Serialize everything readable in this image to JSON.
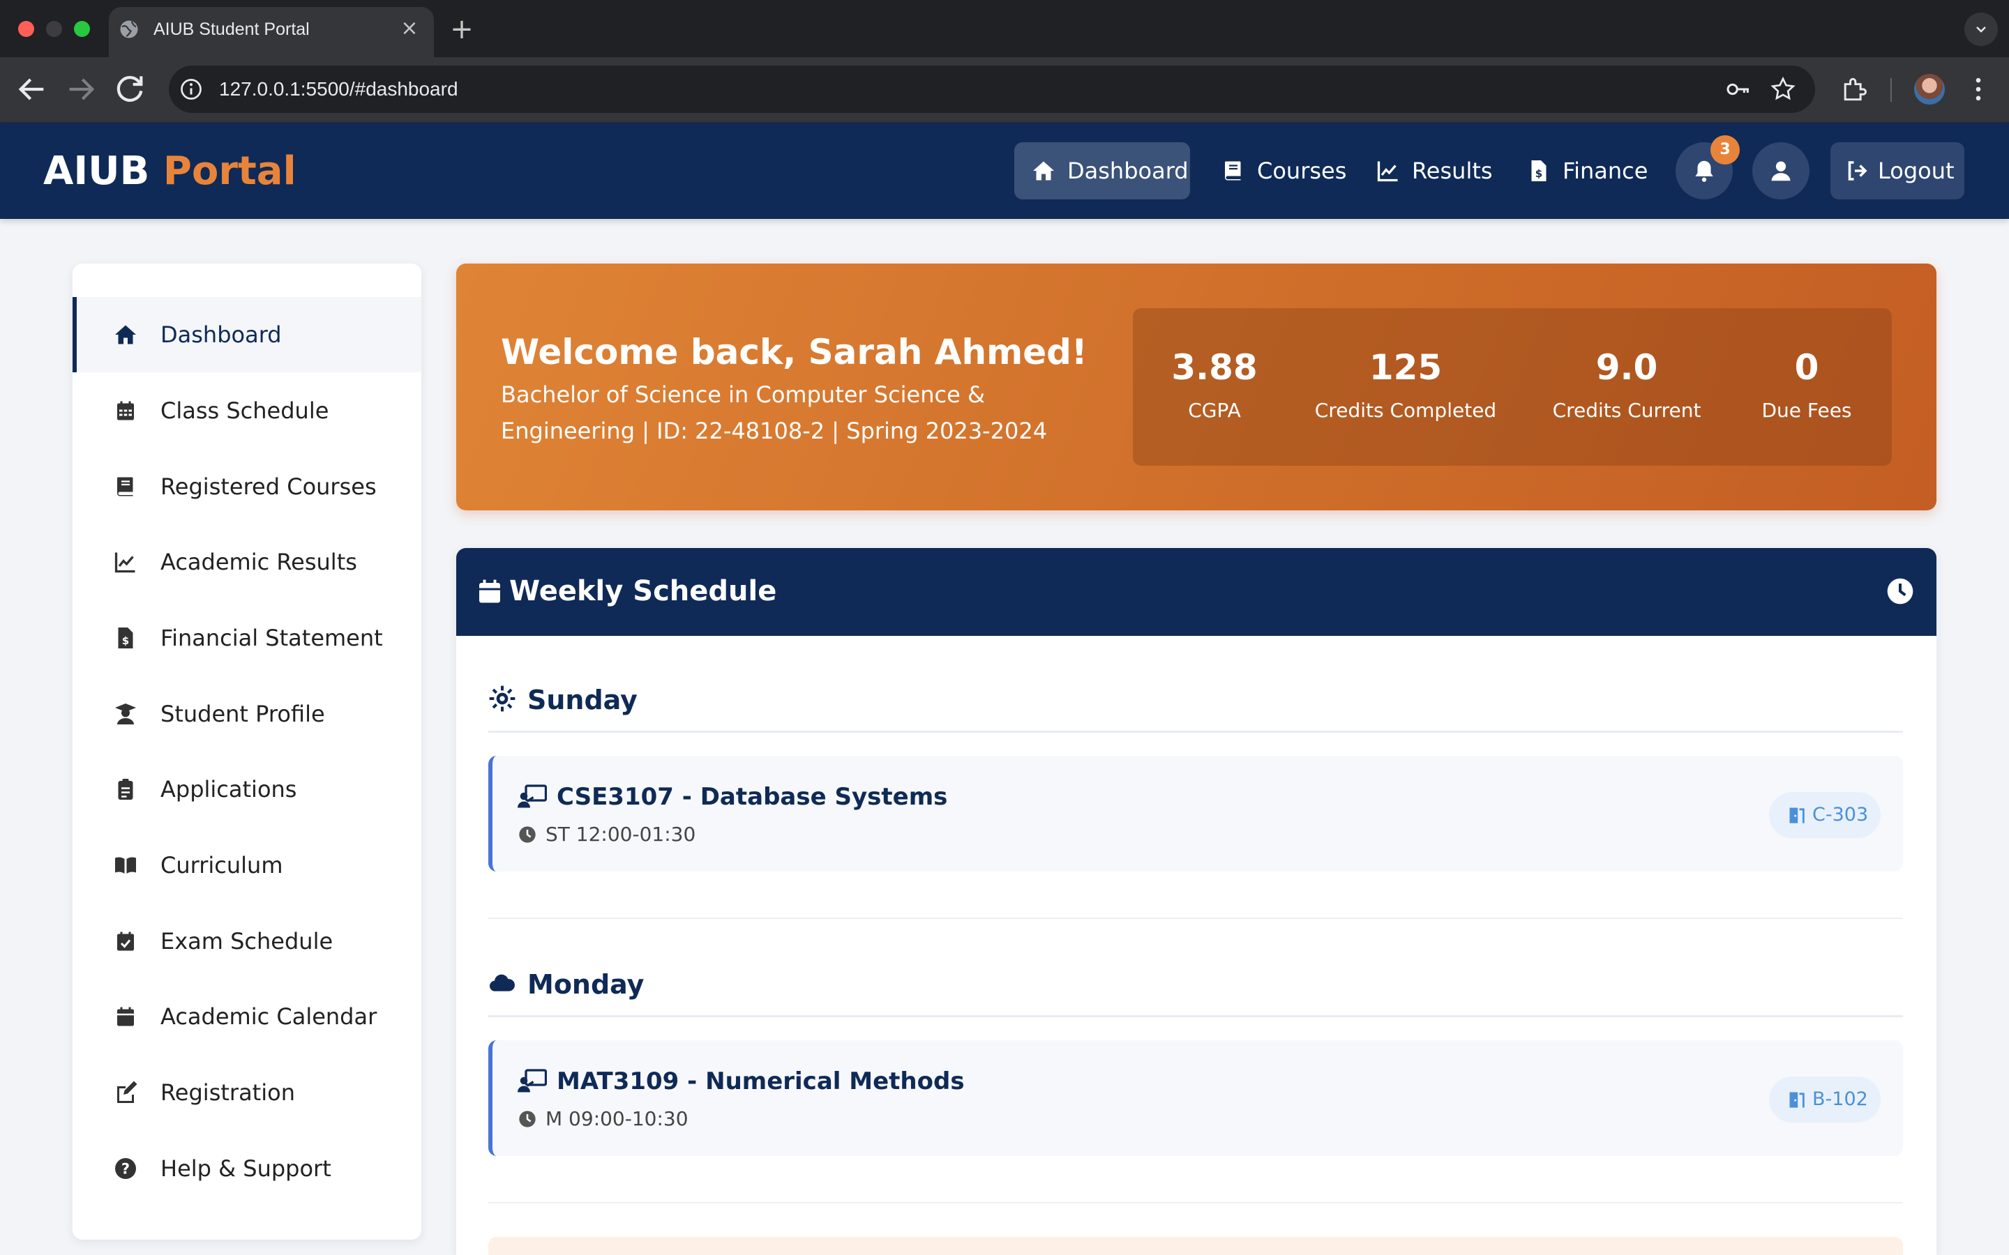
{
  "browser": {
    "tab_title": "AIUB Student Portal",
    "tab_close": "×",
    "new_tab": "+",
    "url": "127.0.0.1:5500/#dashboard"
  },
  "header": {
    "brand_part1": "AIUB",
    "brand_part2": "Portal",
    "nav": [
      {
        "label": "Dashboard",
        "icon": "home-icon"
      },
      {
        "label": "Courses",
        "icon": "book-icon"
      },
      {
        "label": "Results",
        "icon": "chart-line-icon"
      },
      {
        "label": "Finance",
        "icon": "file-invoice-dollar-icon"
      }
    ],
    "notification_count": "3",
    "logout_label": "Logout"
  },
  "sidebar": {
    "items": [
      {
        "label": "Dashboard",
        "icon": "home-icon"
      },
      {
        "label": "Class Schedule",
        "icon": "calendar-grid-icon"
      },
      {
        "label": "Registered Courses",
        "icon": "book-icon"
      },
      {
        "label": "Academic Results",
        "icon": "chart-line-icon"
      },
      {
        "label": "Financial Statement",
        "icon": "file-invoice-dollar-icon"
      },
      {
        "label": "Student Profile",
        "icon": "user-graduate-icon"
      },
      {
        "label": "Applications",
        "icon": "clipboard-list-icon"
      },
      {
        "label": "Curriculum",
        "icon": "book-open-icon"
      },
      {
        "label": "Exam Schedule",
        "icon": "calendar-check-icon"
      },
      {
        "label": "Academic Calendar",
        "icon": "calendar-icon"
      },
      {
        "label": "Registration",
        "icon": "edit-icon"
      },
      {
        "label": "Help & Support",
        "icon": "question-circle-icon"
      }
    ]
  },
  "welcome": {
    "title": "Welcome back, Sarah Ahmed!",
    "subtitle": "Bachelor of Science in Computer Science & Engineering | ID: 22-48108-2 | Spring 2023-2024",
    "stats": [
      {
        "value": "3.88",
        "label": "CGPA"
      },
      {
        "value": "125",
        "label": "Credits Completed"
      },
      {
        "value": "9.0",
        "label": "Credits Current"
      },
      {
        "value": "0",
        "label": "Due Fees"
      }
    ]
  },
  "schedule": {
    "title": "Weekly Schedule",
    "days": [
      {
        "name": "Sunday",
        "icon": "sun-icon",
        "classes": [
          {
            "title": "CSE3107 - Database Systems",
            "time": "ST 12:00-01:30",
            "room": "C-303"
          }
        ]
      },
      {
        "name": "Monday",
        "icon": "cloud-icon",
        "classes": [
          {
            "title": "MAT3109 - Numerical Methods",
            "time": "M 09:00-10:30",
            "room": "B-102"
          }
        ]
      }
    ]
  },
  "colors": {
    "navy": "#0f2a56",
    "orange": "#e8843a",
    "accent_blue": "#4a73d6",
    "room_blue": "#4a90d9"
  }
}
